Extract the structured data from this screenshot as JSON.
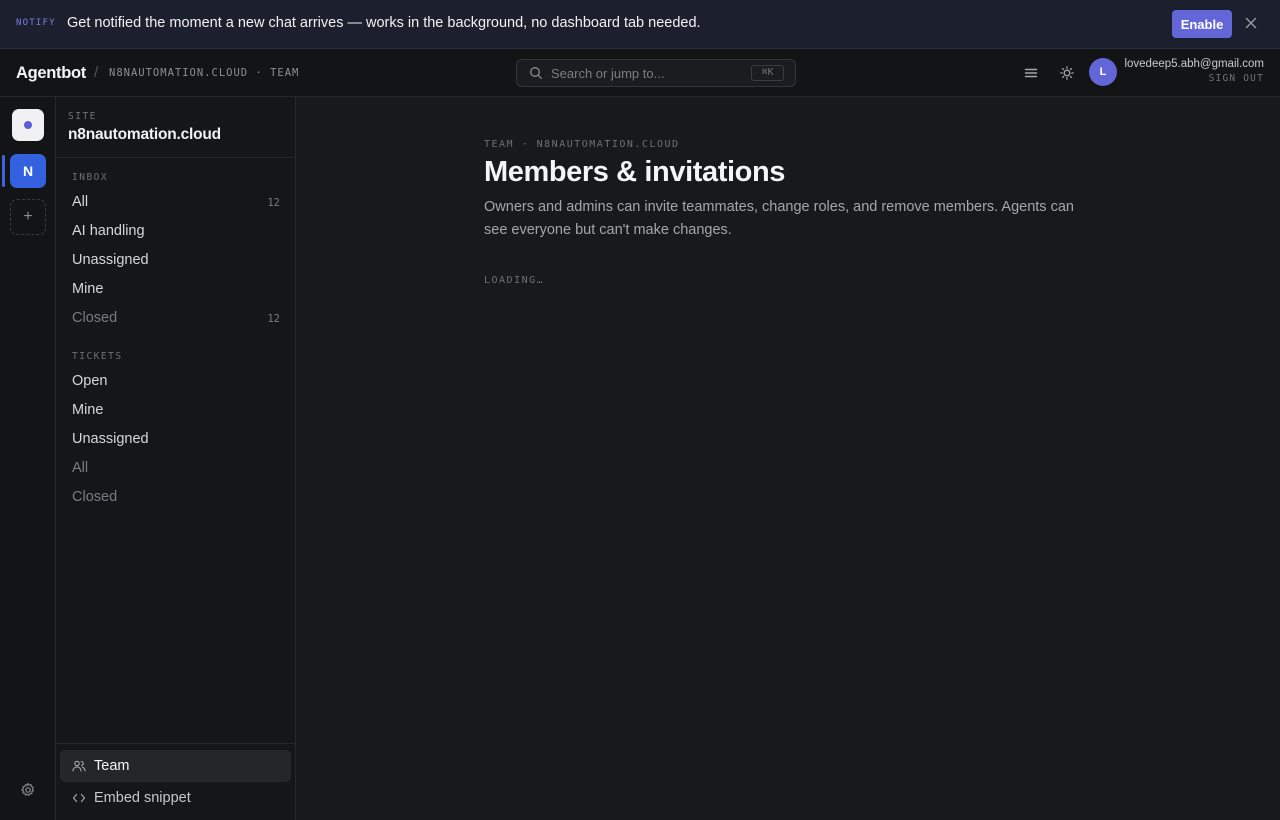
{
  "banner": {
    "tag": "NOTIFY",
    "message": "Get notified the moment a new chat arrives — works in the background, no dashboard tab needed.",
    "enable_label": "Enable",
    "close_icon": "close-icon"
  },
  "header": {
    "brand": "Agentbot",
    "separator": "/",
    "breadcrumb": "N8NAUTOMATION.CLOUD · TEAM",
    "search_placeholder": "Search or jump to...",
    "search_shortcut": "⌘K",
    "menu_icon": "menu-icon",
    "theme_icon": "sun-icon",
    "avatar_initial": "L",
    "user_email": "lovedeep5.abh@gmail.com",
    "sign_out": "SIGN OUT"
  },
  "rail": {
    "workspace_initial": "N",
    "add_label": "+",
    "settings_icon": "gear-icon"
  },
  "sidebar": {
    "site_label": "SITE",
    "site_name": "n8nautomation.cloud",
    "inbox_label": "INBOX",
    "inbox_items": [
      {
        "label": "All",
        "count": "12"
      },
      {
        "label": "AI handling",
        "count": ""
      },
      {
        "label": "Unassigned",
        "count": ""
      },
      {
        "label": "Mine",
        "count": ""
      },
      {
        "label": "Closed",
        "count": "12"
      }
    ],
    "tickets_label": "TICKETS",
    "ticket_items": [
      {
        "label": "Open"
      },
      {
        "label": "Mine"
      },
      {
        "label": "Unassigned"
      },
      {
        "label": "All"
      },
      {
        "label": "Closed"
      }
    ],
    "bottom": {
      "team_label": "Team",
      "embed_label": "Embed snippet"
    }
  },
  "main": {
    "eyebrow": "TEAM · N8NAUTOMATION.CLOUD",
    "title": "Members & invitations",
    "description": "Owners and admins can invite teammates, change roles, and remove members. Agents can see everyone but can't make changes.",
    "loading": "LOADING…"
  },
  "colors": {
    "accent": "#6366d6",
    "workspace": "#3461e0",
    "background": "#18191b"
  }
}
